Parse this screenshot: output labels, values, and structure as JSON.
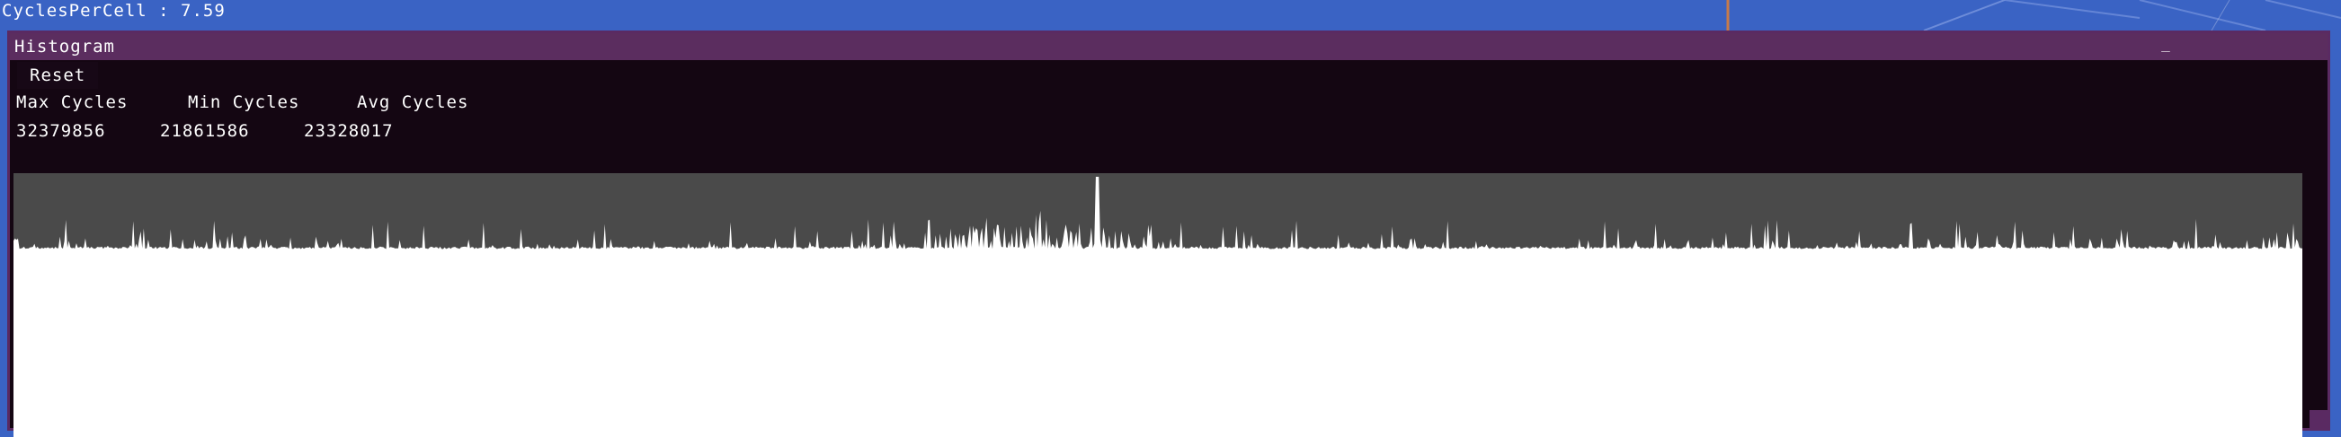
{
  "overlay": {
    "cycles_per_cell": "CyclesPerCell : 7.59"
  },
  "window": {
    "title": "Histogram",
    "minimize_glyph": "_"
  },
  "controls": {
    "reset_label": "Reset"
  },
  "stats": {
    "headers": [
      "Max Cycles",
      "Min Cycles",
      "Avg Cycles"
    ],
    "values": [
      "32379856",
      "21861586",
      "23328017"
    ]
  },
  "colors": {
    "desktop": "#3a63c4",
    "window_bg": "#140612",
    "titlebar": "#5b2d5f",
    "plot_bg": "#4a4a4a",
    "plot_fill": "#ffffff"
  },
  "chart_data": {
    "type": "area",
    "series_length": 1530,
    "ymin": 21861586,
    "ymax": 32379856,
    "baseline": 23328017
  }
}
